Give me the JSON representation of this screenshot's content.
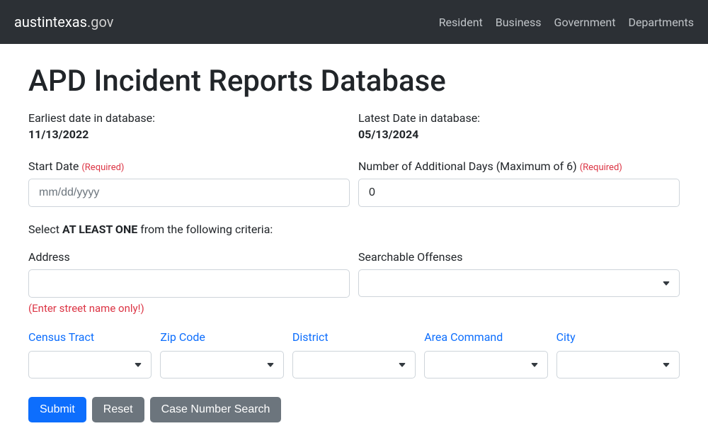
{
  "header": {
    "brand_main": "austintexas",
    "brand_domain": ".gov",
    "nav": [
      "Resident",
      "Business",
      "Government",
      "Departments"
    ]
  },
  "page": {
    "title": "APD Incident Reports Database",
    "earliest_label": "Earliest date in database:",
    "earliest_value": "11/13/2022",
    "latest_label": "Latest Date in database:",
    "latest_value": "05/13/2024"
  },
  "form": {
    "start_date_label": "Start Date",
    "start_date_placeholder": "mm/dd/yyyy",
    "days_label": "Number of Additional Days (Maximum of 6)",
    "days_value": "0",
    "required_tag": "(Required)",
    "criteria_prefix": "Select ",
    "criteria_emphasis": "AT LEAST ONE",
    "criteria_suffix": " from the following criteria:",
    "address_label": "Address",
    "address_help": "(Enter street name only!)",
    "offenses_label": "Searchable Offenses",
    "filters": {
      "census_tract": "Census Tract",
      "zip_code": "Zip Code",
      "district": "District",
      "area_command": "Area Command",
      "city": "City"
    },
    "buttons": {
      "submit": "Submit",
      "reset": "Reset",
      "case_search": "Case Number Search"
    }
  }
}
